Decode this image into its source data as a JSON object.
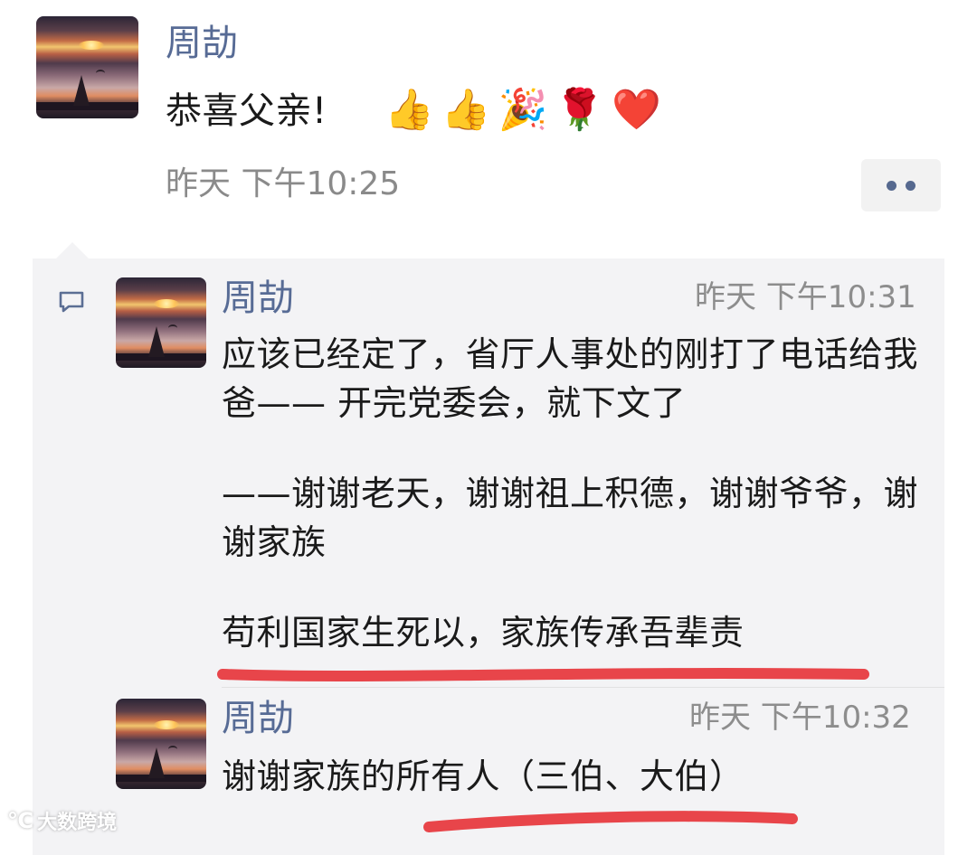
{
  "post": {
    "author": "周劼",
    "text": "恭喜父亲!",
    "emojis": [
      "👍",
      "👍",
      "🎉",
      "🌹",
      "❤️"
    ],
    "time": "昨天 下午10:25"
  },
  "comments": [
    {
      "author": "周劼",
      "time": "昨天 下午10:31",
      "paragraphs": [
        "应该已经定了，省厅人事处的刚打了电话给我爸—— 开完党委会，就下文了",
        "——谢谢老天，谢谢祖上积德，谢谢爷爷，谢谢家族",
        "苟利国家生死以，家族传承吾辈责"
      ]
    },
    {
      "author": "周劼",
      "time": "昨天 下午10:32",
      "text": "谢谢家族的所有人（三伯、大伯）"
    }
  ],
  "watermark": {
    "logo": "℃",
    "text": "大数跨境"
  },
  "colors": {
    "name": "#576b95",
    "underline": "#e8454a",
    "panel": "#f3f3f5"
  },
  "icons": {
    "more": "more-dots-icon",
    "comment": "comment-bubble-icon"
  }
}
